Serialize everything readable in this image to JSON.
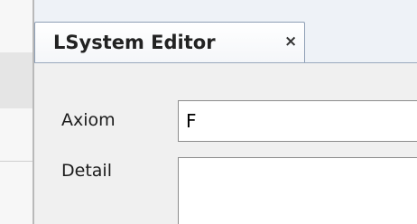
{
  "editor": {
    "tab": {
      "title": "LSystem Editor",
      "close_glyph": "×",
      "close_icon": "close-icon"
    },
    "fields": {
      "axiom": {
        "label": "Axiom",
        "value": "F"
      },
      "detail": {
        "label": "Detail",
        "value": ""
      }
    }
  }
}
